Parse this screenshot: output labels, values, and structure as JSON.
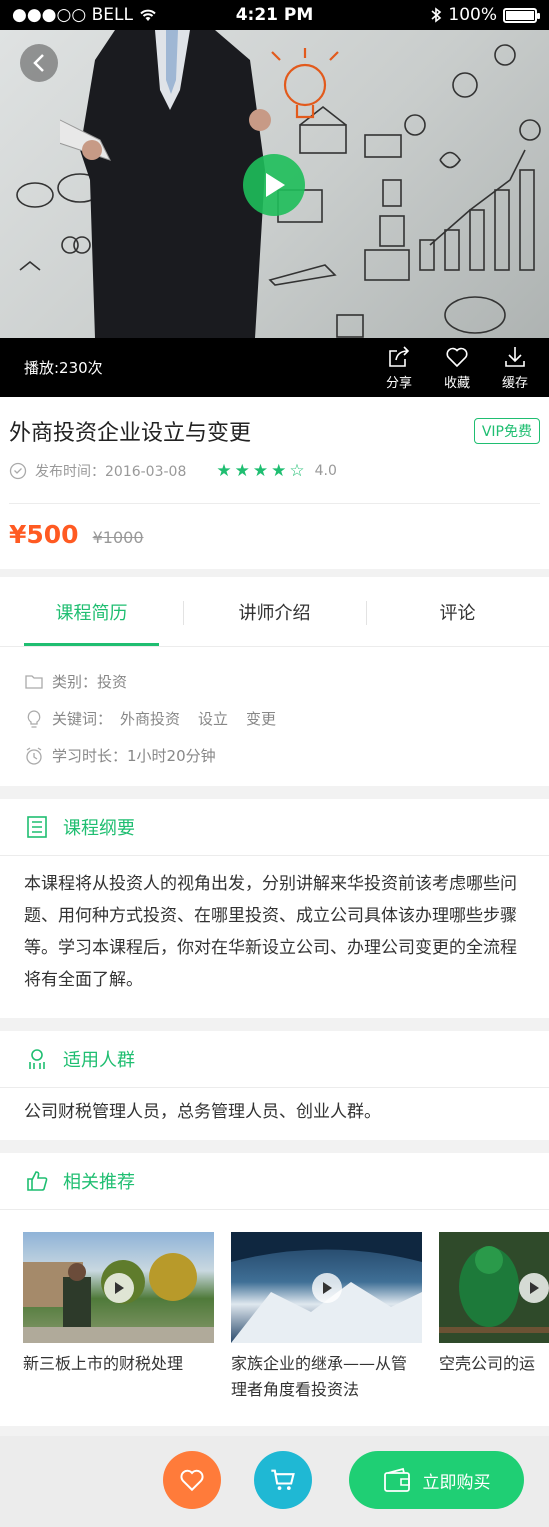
{
  "status_bar": {
    "carrier": "●●●○○ BELL",
    "time": "4:21 PM",
    "battery": "100%",
    "battery_level": 1.0
  },
  "video": {
    "play_count": "播放:230次",
    "actions": [
      {
        "label": "分享",
        "icon": "share-icon"
      },
      {
        "label": "收藏",
        "icon": "heart-icon"
      },
      {
        "label": "缓存",
        "icon": "download-icon"
      }
    ]
  },
  "course": {
    "title": "外商投资企业设立与变更",
    "badge": "VIP免费",
    "publish_label": "发布时间：2016-03-08",
    "stars_filled": 4,
    "stars_total": 5,
    "rating": "4.0",
    "price": "¥500",
    "original_price": "¥1000"
  },
  "tabs": [
    {
      "label": "课程简历",
      "active": true
    },
    {
      "label": "讲师介绍",
      "active": false
    },
    {
      "label": "评论",
      "active": false
    }
  ],
  "details": {
    "category": "类别：投资",
    "keywords_label": "关键词：",
    "keywords": [
      "外商投资",
      "设立",
      "变更"
    ],
    "duration": "学习时长：1小时20分钟"
  },
  "outline": {
    "title": "课程纲要",
    "body": "本课程将从投资人的视角出发，分别讲解来华投资前该考虑哪些问题、用何种方式投资、在哪里投资、成立公司具体该办理哪些步骤等。学习本课程后，你对在华新设立公司、办理公司变更的全流程将有全面了解。"
  },
  "audience": {
    "title": "适用人群",
    "body": "公司财税管理人员，总务管理人员、创业人群。"
  },
  "recommend": {
    "title": "相关推荐",
    "items": [
      {
        "title": "新三板上市的财税处理"
      },
      {
        "title": "家族企业的继承——从管理者角度看投资法"
      },
      {
        "title": "空壳公司的运"
      }
    ]
  },
  "bottom": {
    "buy_label": "立即购买"
  },
  "colors": {
    "accent": "#1fbe71",
    "price": "#ff5a22",
    "favorite": "#ff7b3a",
    "cart": "#1fb8d4",
    "buy": "#1fcf74"
  }
}
